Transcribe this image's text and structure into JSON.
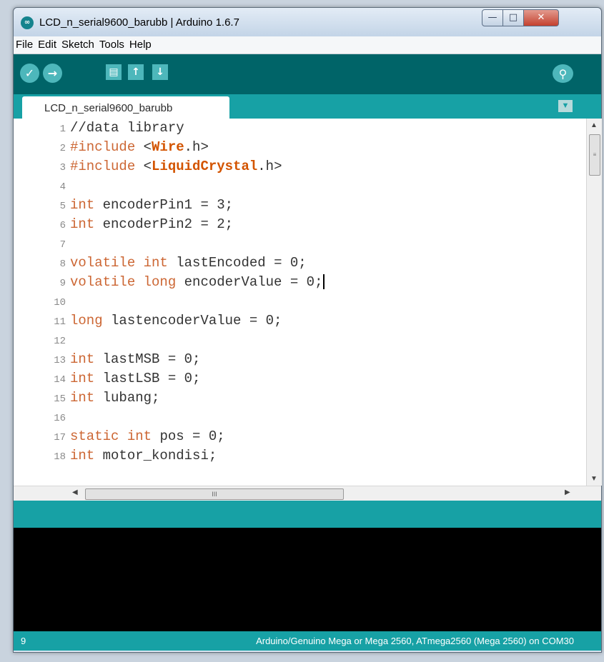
{
  "window": {
    "title": "LCD_n_serial9600_barubb | Arduino 1.6.7",
    "app_icon_glyph": "∞",
    "minimize_glyph": "—",
    "maximize_glyph": "□",
    "close_glyph": "✕"
  },
  "menu": [
    "File",
    "Edit",
    "Sketch",
    "Tools",
    "Help"
  ],
  "toolbar": {
    "verify_glyph": "✓",
    "upload_glyph": "→",
    "new_glyph": "▤",
    "open_glyph": "↑",
    "save_glyph": "↓",
    "monitor_glyph": "⚲"
  },
  "tab": {
    "label": "LCD_n_serial9600_barubb",
    "menu_glyph": "▼"
  },
  "editor": {
    "lines": [
      {
        "n": "1",
        "code": "//data library"
      },
      {
        "n": "2",
        "kw": "#include",
        "lt": " <",
        "lib": "Wire",
        "rest": ".h>"
      },
      {
        "n": "3",
        "kw": "#include",
        "lt": " <",
        "lib": "LiquidCrystal",
        "rest": ".h>"
      },
      {
        "n": "4",
        "code": ""
      },
      {
        "n": "5",
        "kw": "int",
        "code": " encoderPin1 = 3;"
      },
      {
        "n": "6",
        "kw": "int",
        "code": " encoderPin2 = 2;"
      },
      {
        "n": "7",
        "code": ""
      },
      {
        "n": "8",
        "kw": "volatile",
        "kw2": "int",
        "code": " lastEncoded = 0;"
      },
      {
        "n": "9",
        "kw": "volatile",
        "kw2": "long",
        "code": " encoderValue = 0;"
      },
      {
        "n": "10",
        "code": ""
      },
      {
        "n": "11",
        "kw": "long",
        "code": " lastencoderValue = 0;"
      },
      {
        "n": "12",
        "code": ""
      },
      {
        "n": "13",
        "kw": "int",
        "code": " lastMSB = 0;"
      },
      {
        "n": "14",
        "kw": "int",
        "code": " lastLSB = 0;"
      },
      {
        "n": "15",
        "kw": "int",
        "code": " lubang;"
      },
      {
        "n": "16",
        "code": ""
      },
      {
        "n": "17",
        "kw": "static",
        "kw2": "int",
        "code": " pos = 0;"
      },
      {
        "n": "18",
        "kw": "int",
        "code": " motor_kondisi;"
      }
    ]
  },
  "scroll": {
    "up_glyph": "▲",
    "down_glyph": "▼",
    "vthumb_glyph": "≡",
    "left_glyph": "◀",
    "right_glyph": "▶",
    "hthumb_glyph": "III"
  },
  "status": {
    "line": "9",
    "board": "Arduino/Genuino Mega or Mega 2560, ATmega2560 (Mega 2560) on COM30"
  },
  "colors": {
    "toolbar": "#006468",
    "accent": "#17a1a5",
    "keyword": "#cc6633",
    "library": "#d35400"
  }
}
